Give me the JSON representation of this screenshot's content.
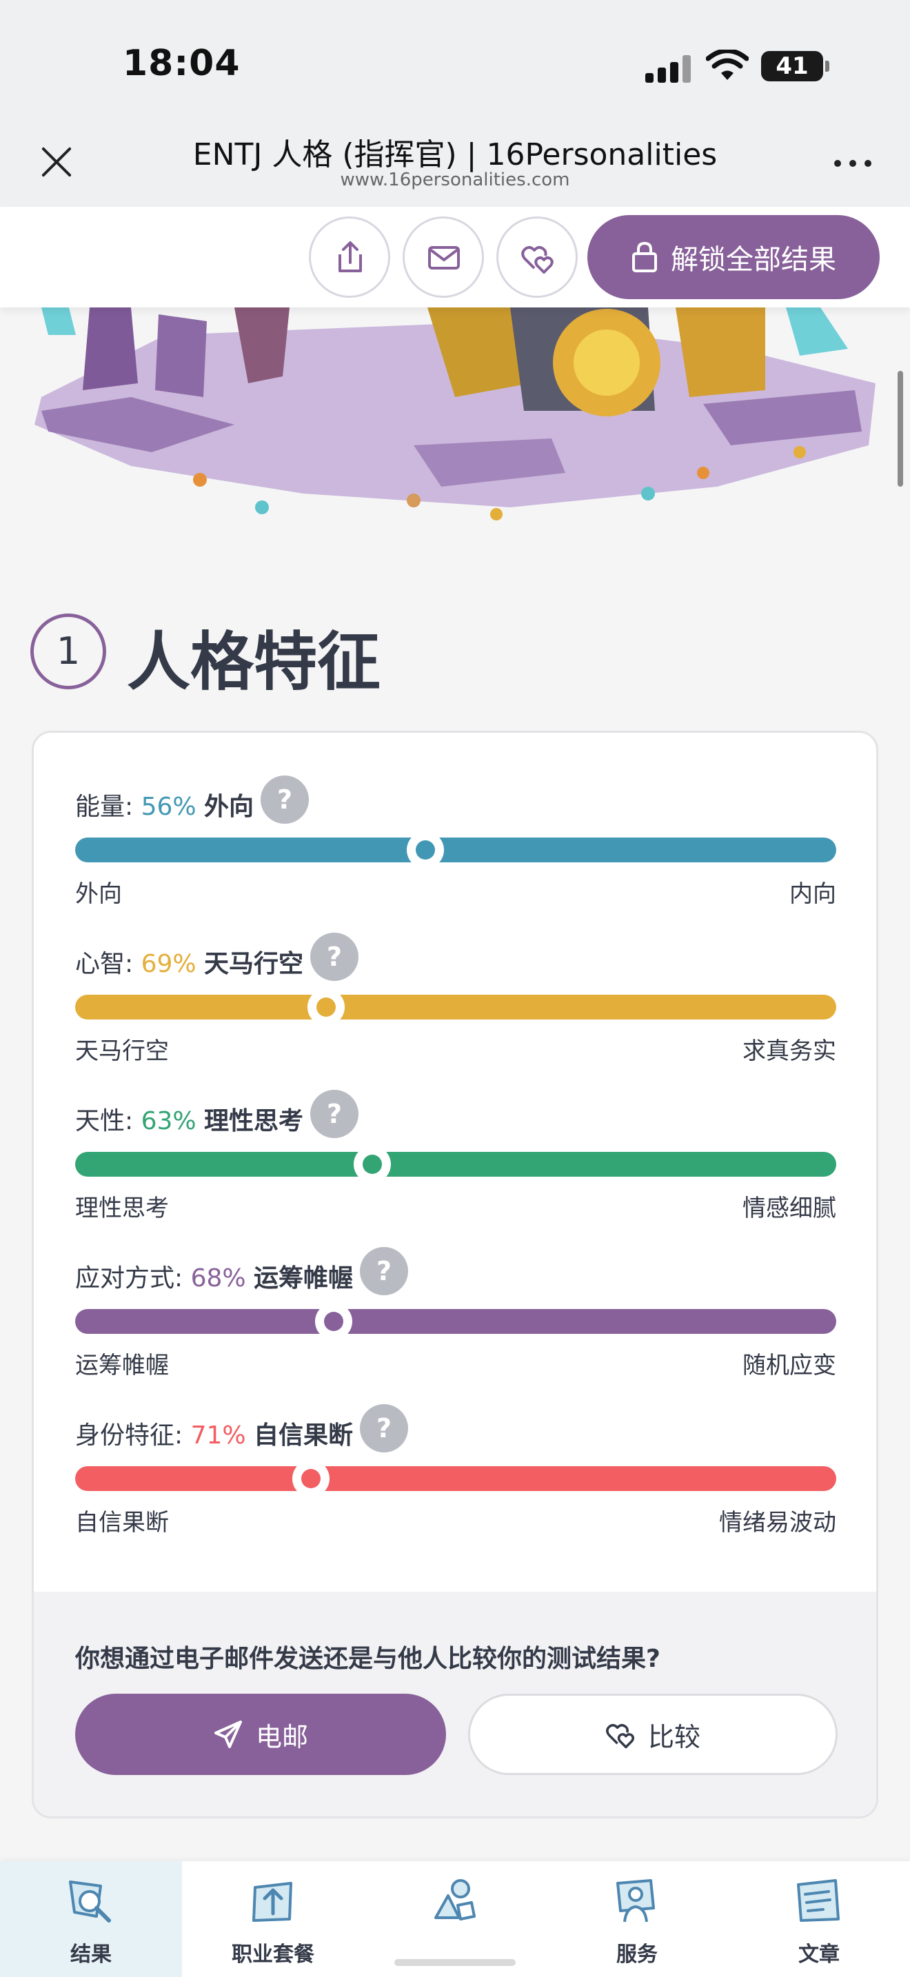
{
  "status_bar": {
    "time": "18:04",
    "battery": "41"
  },
  "browser": {
    "title": "ENTJ 人格 (指挥官) | 16Personalities",
    "url": "www.16personalities.com"
  },
  "action_bar": {
    "unlock_label": "解锁全部结果"
  },
  "section": {
    "number": "1",
    "title": "人格特征"
  },
  "traits": [
    {
      "label": "能量: ",
      "percent": "56%",
      "value": "外向",
      "left_pole": "外向",
      "right_pole": "内向",
      "position": 0.46,
      "color": "#4298b4"
    },
    {
      "label": "心智: ",
      "percent": "69%",
      "value": "天马行空",
      "left_pole": "天马行空",
      "right_pole": "求真务实",
      "position": 0.33,
      "color": "#e4ae3a"
    },
    {
      "label": "天性: ",
      "percent": "63%",
      "value": "理性思考",
      "left_pole": "理性思考",
      "right_pole": "情感细腻",
      "position": 0.39,
      "color": "#33a474"
    },
    {
      "label": "应对方式: ",
      "percent": "68%",
      "value": "运筹帷幄",
      "left_pole": "运筹帷幄",
      "right_pole": "随机应变",
      "position": 0.34,
      "color": "#88619a"
    },
    {
      "label": "身份特征: ",
      "percent": "71%",
      "value": "自信果断",
      "left_pole": "自信果断",
      "right_pole": "情绪易波动",
      "position": 0.31,
      "color": "#f25e62"
    }
  ],
  "share": {
    "question": "你想通过电子邮件发送还是与他人比较你的测试结果?",
    "email_label": "电邮",
    "compare_label": "比较"
  },
  "bottom_nav": [
    {
      "label": "结果",
      "icon": "results-icon",
      "active": true
    },
    {
      "label": "职业套餐",
      "icon": "career-icon",
      "active": false
    },
    {
      "label": "",
      "icon": "shapes-icon",
      "active": false
    },
    {
      "label": "服务",
      "icon": "services-icon",
      "active": false
    },
    {
      "label": "文章",
      "icon": "articles-icon",
      "active": false
    }
  ]
}
